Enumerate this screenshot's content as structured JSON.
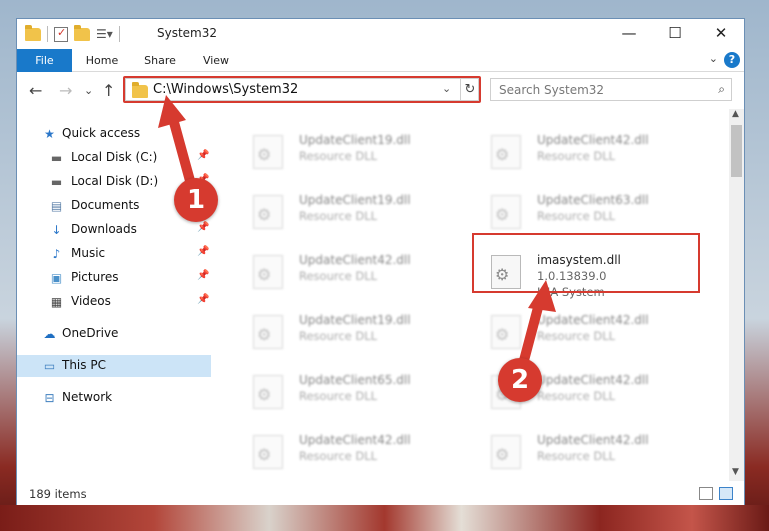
{
  "window": {
    "title": "System32"
  },
  "controls": {
    "minimize": "—",
    "maximize": "☐",
    "close": "✕"
  },
  "ribbon": {
    "tabs": [
      "File",
      "Home",
      "Share",
      "View"
    ],
    "help": "?",
    "expand": "⌄"
  },
  "nav": {
    "back": "←",
    "forward": "→",
    "recent": "⌄",
    "up": "↑",
    "address": "C:\\Windows\\System32",
    "address_dropdown": "⌄",
    "refresh": "↻",
    "search_placeholder": "Search System32",
    "search_icon": "⌕"
  },
  "sidebar": {
    "items": [
      {
        "label": "Quick access",
        "icon": "star-icon",
        "glyph": "★",
        "color": "#2b77c9",
        "pinned": false
      },
      {
        "label": "Local Disk (C:)",
        "icon": "drive-icon",
        "glyph": "▬",
        "color": "#666666",
        "pinned": true
      },
      {
        "label": "Local Disk (D:)",
        "icon": "drive-icon",
        "glyph": "▬",
        "color": "#666666",
        "pinned": true
      },
      {
        "label": "Documents",
        "icon": "documents-icon",
        "glyph": "▤",
        "color": "#5b7fa8",
        "pinned": true
      },
      {
        "label": "Downloads",
        "icon": "download-icon",
        "glyph": "↓",
        "color": "#2b77c9",
        "pinned": true
      },
      {
        "label": "Music",
        "icon": "music-icon",
        "glyph": "♪",
        "color": "#2b77c9",
        "pinned": true
      },
      {
        "label": "Pictures",
        "icon": "pictures-icon",
        "glyph": "▣",
        "color": "#4a90c9",
        "pinned": true
      },
      {
        "label": "Videos",
        "icon": "videos-icon",
        "glyph": "▦",
        "color": "#444444",
        "pinned": true
      },
      {
        "label": "OneDrive",
        "icon": "cloud-icon",
        "glyph": "☁",
        "color": "#1f6fc2",
        "pinned": false
      },
      {
        "label": "This PC",
        "icon": "computer-icon",
        "glyph": "▭",
        "color": "#3f7fbf",
        "pinned": false,
        "selected": true
      },
      {
        "label": "Network",
        "icon": "network-icon",
        "glyph": "⊟",
        "color": "#3f7fbf",
        "pinned": false
      }
    ]
  },
  "files": {
    "left": [
      {
        "name": "UpdateClient19.dll",
        "type": "Resource DLL"
      },
      {
        "name": "UpdateClient19.dll",
        "type": "Resource DLL"
      },
      {
        "name": "UpdateClient42.dll",
        "type": "Resource DLL"
      },
      {
        "name": "UpdateClient19.dll",
        "type": "Resource DLL"
      },
      {
        "name": "UpdateClient65.dll",
        "type": "Resource DLL"
      },
      {
        "name": "UpdateClient42.dll",
        "type": "Resource DLL"
      }
    ],
    "right": [
      {
        "name": "UpdateClient42.dll",
        "type": "Resource DLL"
      },
      {
        "name": "UpdateClient63.dll",
        "type": "Resource DLL"
      },
      {
        "name": "imasystem.dll",
        "version": "1.0.13839.0",
        "type": "IMA System",
        "highlighted": true
      },
      {
        "name": "UpdateClient42.dll",
        "type": "Resource DLL"
      },
      {
        "name": "UpdateClient42.dll",
        "type": "Resource DLL"
      },
      {
        "name": "UpdateClient42.dll",
        "type": "Resource DLL"
      }
    ]
  },
  "status": {
    "item_count": "189 items"
  },
  "callouts": [
    "1",
    "2"
  ],
  "colors": {
    "accent": "#1979ca",
    "highlight": "#d63a2f",
    "selection": "#cce4f7"
  }
}
